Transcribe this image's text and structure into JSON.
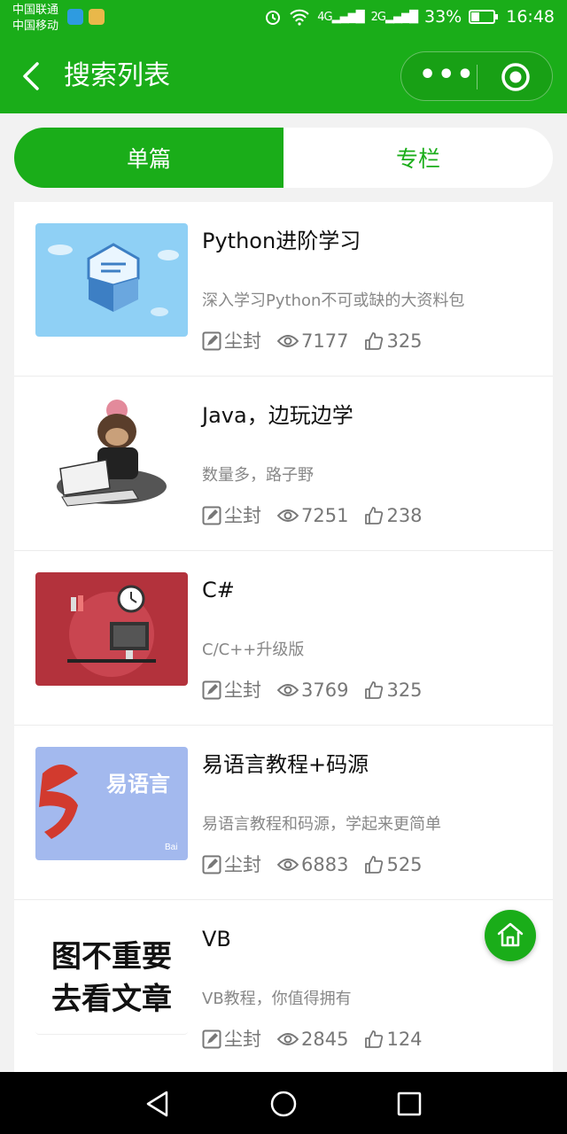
{
  "status_bar": {
    "carrier_1": "中国联通",
    "carrier_2": "中国移动",
    "signal_1": "4G",
    "signal_2": "2G",
    "battery": "33%",
    "time": "16:48"
  },
  "nav": {
    "title": "搜索列表",
    "menu_icon": "more-dots-icon",
    "close_icon": "target-circle-icon"
  },
  "tabs": [
    {
      "label": "单篇",
      "active": true
    },
    {
      "label": "专栏",
      "active": false
    }
  ],
  "articles": [
    {
      "title": "Python进阶学习",
      "desc": "深入学习Python不可或缺的大资料包",
      "author": "尘封",
      "views": "7177",
      "likes": "325",
      "thumb": "python-logo-image"
    },
    {
      "title": "Java，边玩边学",
      "desc": "数量多，路子野",
      "author": "尘封",
      "views": "7251",
      "likes": "238",
      "thumb": "monkey-programmer-image"
    },
    {
      "title": "C#",
      "desc": "C/C++升级版",
      "author": "尘封",
      "views": "3769",
      "likes": "325",
      "thumb": "desk-computer-image"
    },
    {
      "title": "易语言教程+码源",
      "desc": "易语言教程和码源，学起来更简单",
      "author": "尘封",
      "views": "6883",
      "likes": "525",
      "thumb": "yi-language-logo-image",
      "thumb_text": "易语言",
      "thumb_watermark": "Bai"
    },
    {
      "title": "VB",
      "desc": "VB教程，你值得拥有",
      "author": "尘封",
      "views": "2845",
      "likes": "124",
      "thumb": "text-placeholder-image",
      "thumb_line_1": "图不重要",
      "thumb_line_2": "去看文章"
    }
  ],
  "colors": {
    "brand_green": "#1aad19",
    "text_main": "#111111",
    "text_sub": "#888888"
  },
  "fab_icon": "home-icon",
  "system_nav": [
    "back-triangle-icon",
    "home-circle-icon",
    "recent-square-icon"
  ]
}
